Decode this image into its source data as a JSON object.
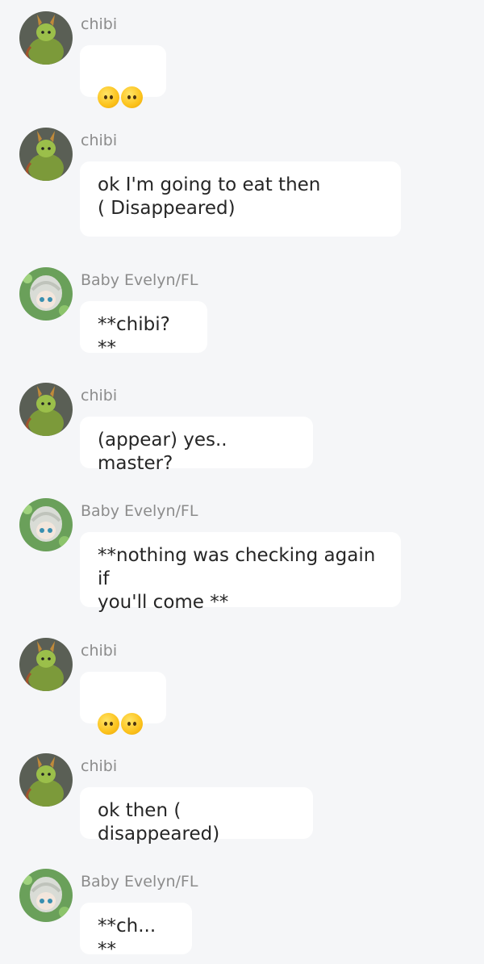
{
  "messages": [
    {
      "sender": "chibi",
      "avatar": "chibi-avatar",
      "text": "",
      "emoji": [
        "face-without-mouth",
        "face-without-mouth"
      ]
    },
    {
      "sender": "chibi",
      "avatar": "chibi-avatar",
      "text": "ok I'm going to eat then\n( Disappeared)"
    },
    {
      "sender": "Baby Evelyn/FL",
      "avatar": "evelyn-avatar",
      "text": "**chibi? **"
    },
    {
      "sender": "chibi",
      "avatar": "chibi-avatar",
      "text": "(appear) yes.. master?"
    },
    {
      "sender": "Baby Evelyn/FL",
      "avatar": "evelyn-avatar",
      "text": "**nothing was checking again if\nyou'll come **"
    },
    {
      "sender": "chibi",
      "avatar": "chibi-avatar",
      "text": "",
      "emoji": [
        "face-without-mouth",
        "face-without-mouth"
      ]
    },
    {
      "sender": "chibi",
      "avatar": "chibi-avatar",
      "text": "ok then ( disappeared)"
    },
    {
      "sender": "Baby Evelyn/FL",
      "avatar": "evelyn-avatar",
      "text": "**ch... **"
    }
  ]
}
